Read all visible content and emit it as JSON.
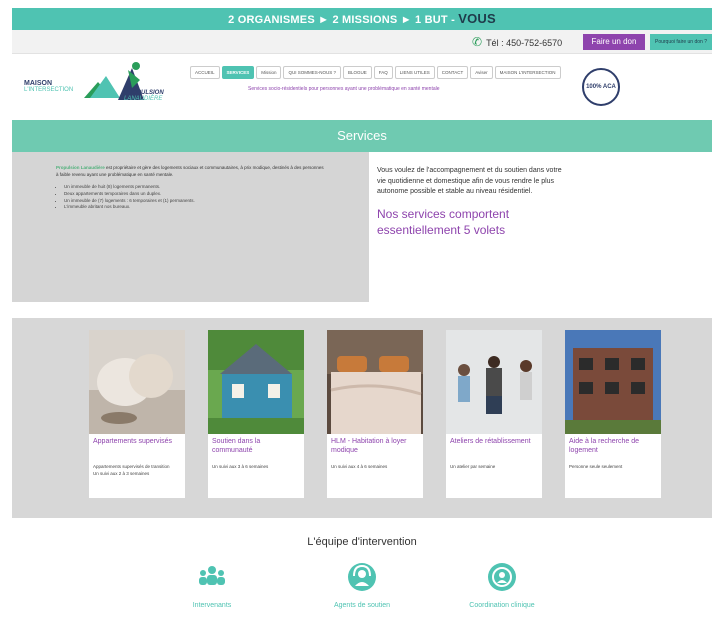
{
  "topbar": {
    "text": "2 ORGANISMES ► 2 MISSIONS ► 1 BUT -",
    "highlight": "VOUS"
  },
  "contact": {
    "phone": "Tél : 450-752-6570",
    "donate_label": "Faire un don",
    "why_label": "Pourquoi faire un don ?"
  },
  "logo": {
    "maison_line1": "MAISON",
    "maison_line2": "L'INTERSECTION",
    "propulsion_line1": "PROPULSION",
    "propulsion_line2": "LANAUDIÈRE"
  },
  "nav": {
    "items": [
      "ACCUEIL",
      "SERVICES",
      "Mission",
      "QUI SOMMES-NOUS ?",
      "BLOGUE",
      "FAQ",
      "LIENS UTILES",
      "CONTACT",
      "Aviser",
      "MAISON L'INTERSECTION"
    ],
    "tagline": "Services socio-résidentiels pour personnes ayant une problématique en santé mentale"
  },
  "badge": "100% ACA",
  "banner": {
    "title": "Services"
  },
  "intro": {
    "org_name": "Propulsion Lanaudière",
    "lead": "est propriétaire et gère des logements sociaux et communautaires, à prix modique, destinés à des personnes à faible revenu ayant une problématique en santé mentale.",
    "bullets": [
      "Un immeuble de huit (8) logements permanents.",
      "Deux appartements temporaires dans un duplex.",
      "Un immeuble de (7) logements : 6 temporaires et (1) permanents.",
      "L'immeuble abritant nos bureaux."
    ],
    "right_text": "Vous voulez de l'accompagnement et du soutien dans votre vie quotidienne et domestique afin de vous rendre le plus autonome possible et stable au niveau résidentiel.",
    "heading": "Nos services comportent essentiellement 5 volets"
  },
  "services": [
    {
      "title": "Appartements supervisés",
      "desc": [
        "Appartements supervisés de transition",
        "Un suivi aux 2 à 3 semaines"
      ]
    },
    {
      "title": "Soutien dans la communauté",
      "desc": [
        "Un suivi aux 3 à 6 semaines"
      ]
    },
    {
      "title": "HLM - Habitation à loyer modique",
      "desc": [
        "Un suivi aux 4 à 6 semaines"
      ]
    },
    {
      "title": "Ateliers de rétablissement",
      "desc": [
        "Un atelier par semaine"
      ]
    },
    {
      "title": "Aide à la recherche de logement",
      "desc": [
        "Personne seule seulement"
      ]
    }
  ],
  "team": {
    "title": "L'équipe d'intervention",
    "items": [
      {
        "label": "Intervenants",
        "icon": "group-icon"
      },
      {
        "label": "Agents de soutien",
        "icon": "support-agent-icon"
      },
      {
        "label": "Coordination clinique",
        "icon": "coordinator-icon"
      }
    ]
  },
  "colors": {
    "teal": "#4fc3b2",
    "purple": "#8e44ad",
    "navy": "#2f3e6b"
  }
}
